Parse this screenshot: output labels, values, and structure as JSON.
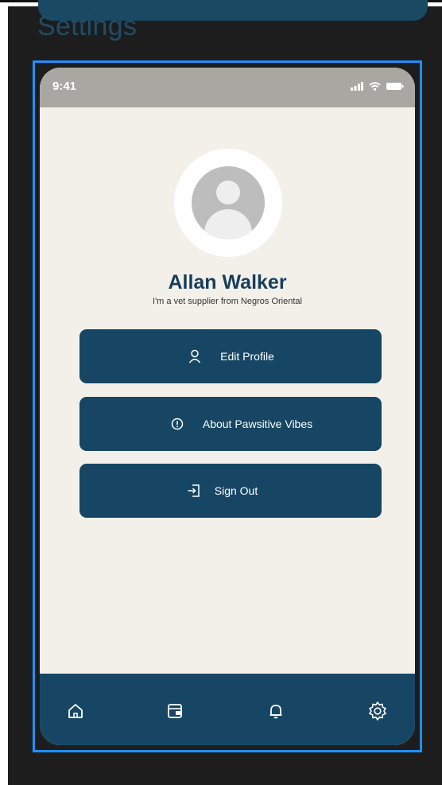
{
  "page": {
    "title": "Settings"
  },
  "status_bar": {
    "time": "9:41",
    "icons": [
      "signal-icon",
      "wifi-icon",
      "battery-icon"
    ]
  },
  "profile": {
    "name": "Allan Walker",
    "bio": "I'm a vet supplier from Negros Oriental",
    "avatar_icon": "user-avatar-icon"
  },
  "menu": {
    "edit_profile": {
      "label": "Edit Profile",
      "icon": "user-icon"
    },
    "about": {
      "label": "About Pawsitive Vibes",
      "icon": "info-icon"
    },
    "sign_out": {
      "label": "Sign Out",
      "icon": "sign-out-icon"
    }
  },
  "bottom_nav": {
    "items": [
      "home-icon",
      "wallet-icon",
      "bell-icon",
      "settings-icon"
    ]
  },
  "colors": {
    "primary": "#174664",
    "background": "#f3f0ea",
    "status_bar": "#a8a7a2",
    "frame_border": "#1e90ff",
    "canvas": "#1d1d1d"
  }
}
